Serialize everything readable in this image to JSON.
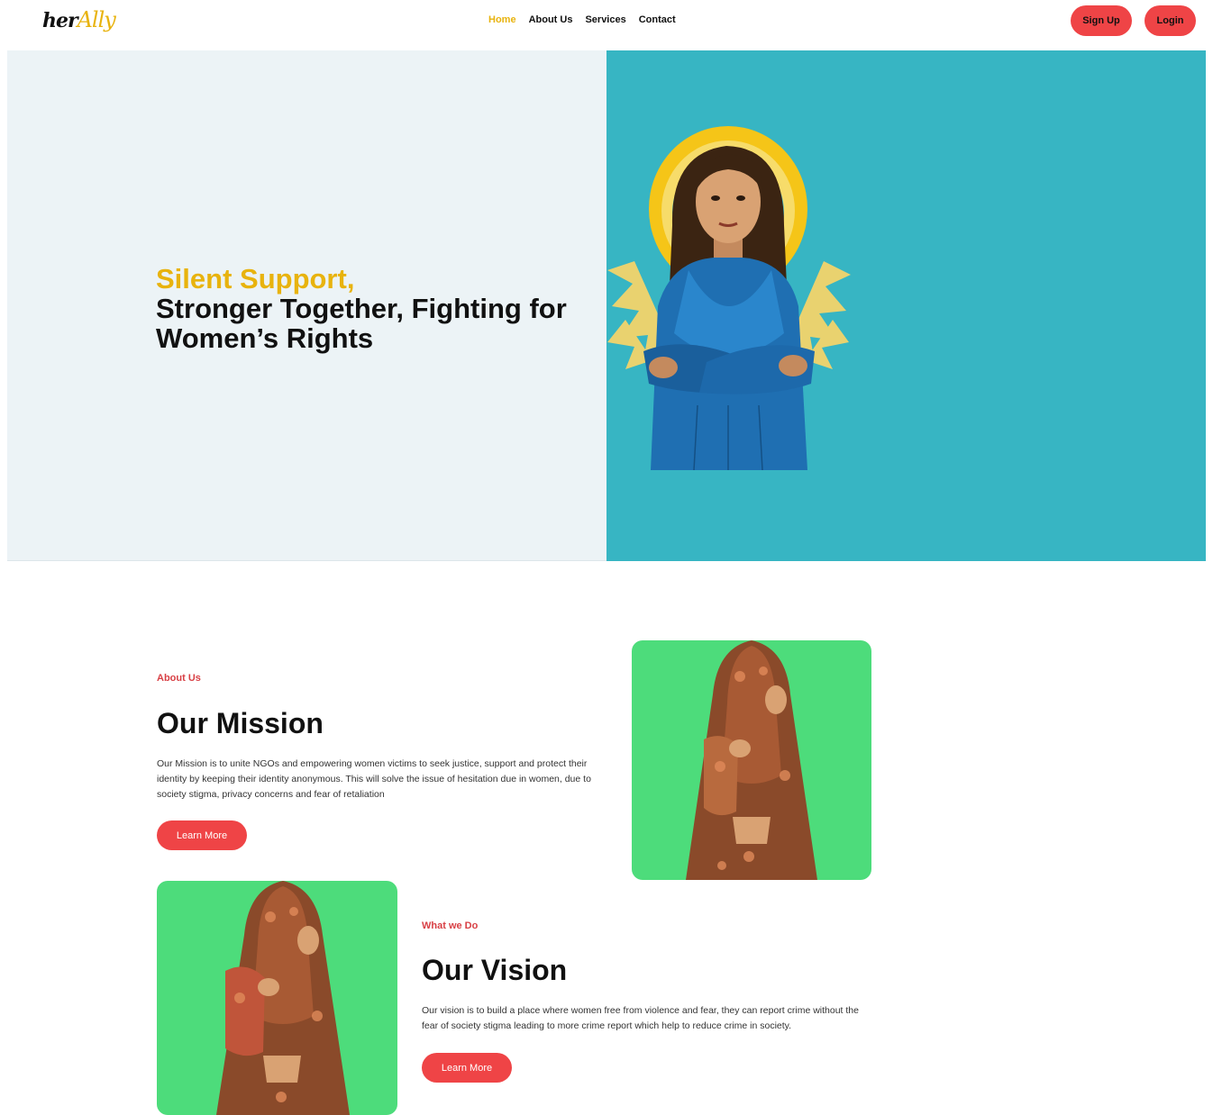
{
  "brand": {
    "logo_part1": "her",
    "logo_part2": "Ally"
  },
  "nav": {
    "items": [
      {
        "label": "Home",
        "active": true
      },
      {
        "label": "About Us",
        "active": false
      },
      {
        "label": "Services",
        "active": false
      },
      {
        "label": "Contact",
        "active": false
      }
    ],
    "signup_label": "Sign Up",
    "login_label": "Login"
  },
  "hero": {
    "highlight": "Silent Support,",
    "headline": "Stronger Together, Fighting for Women’s Rights"
  },
  "about": {
    "label": "About Us",
    "title": "Our Mission",
    "body": "Our Mission is to unite NGOs and empowering women victims to seek justice, support and protect their identity by keeping their identity anonymous. This will solve the issue of hesitation due in women, due to society stigma, privacy concerns and fear of retaliation",
    "button": "Learn More"
  },
  "vision": {
    "label": "What we Do",
    "title": "Our Vision",
    "body": "Our vision is to build a place where women free from violence and fear, they can report crime without the fear of society stigma leading to more crime report which help to reduce crime in society.",
    "button": "Learn More"
  },
  "colors": {
    "accent_yellow": "#e8b30e",
    "accent_red": "#ef4446",
    "hero_teal": "#37b5c3",
    "card_green": "#4ddc7b"
  }
}
